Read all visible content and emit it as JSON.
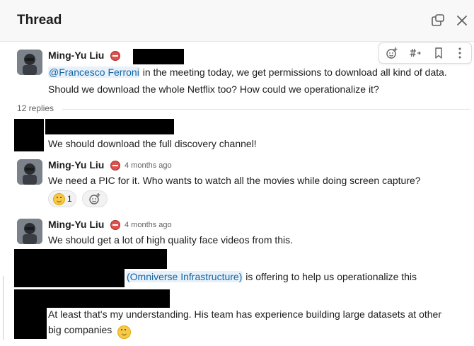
{
  "header": {
    "title": "Thread"
  },
  "icons": {
    "open_window": "open-in-window-icon",
    "close": "close-icon",
    "add_reaction": "add-reaction-icon",
    "forward": "forward-to-channel-icon",
    "bookmark": "bookmark-icon",
    "more": "more-actions-icon",
    "status": "do-not-disturb-icon"
  },
  "parent": {
    "author": "Ming-Yu Liu",
    "mention": "@Francesco Ferroni",
    "line1_rest": " in the meeting today, we get permissions to download all kind of data.",
    "line2": "Should we download the whole Netflix too? How could we operationalize it?"
  },
  "replies_count": "12 replies",
  "messages": [
    {
      "text": "We should download the full discovery channel!"
    },
    {
      "author": "Ming-Yu Liu",
      "time": "4 months ago",
      "text": "We need a PIC for it. Who wants to watch all the movies while doing screen capture?",
      "reaction_count": "1"
    },
    {
      "author": "Ming-Yu Liu",
      "time": "4 months ago",
      "text": "We should get a lot of high quality face videos from this."
    },
    {
      "mention": "(Omniverse Infrastructure)",
      "text_rest": " is offering to help us operationalize this"
    },
    {
      "line1": "At least that's my understanding. His team has experience building large datasets at other",
      "line2": "big companies"
    }
  ],
  "colors": {
    "status_red": "#d9534f",
    "mention_blue": "#1264a3",
    "redaction": "#000000"
  }
}
